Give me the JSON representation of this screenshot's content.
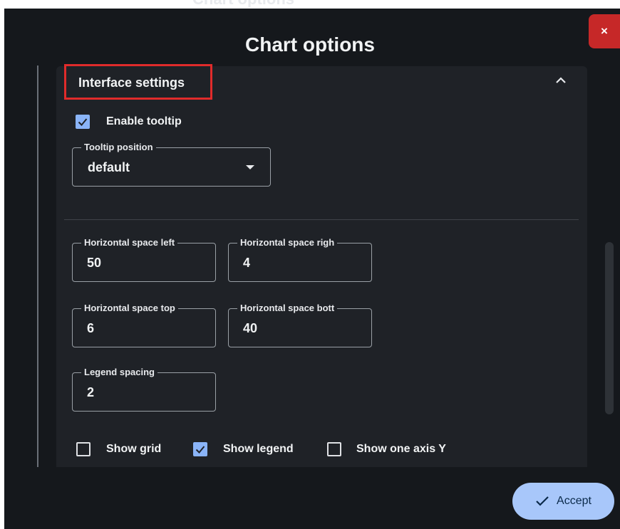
{
  "header_partial": "Chart options",
  "dialog": {
    "title": "Chart options",
    "close_label": "×"
  },
  "section": {
    "title": "Interface settings",
    "expanded": true
  },
  "tooltip": {
    "enable_label": "Enable tooltip",
    "enabled": true,
    "position_label": "Tooltip position",
    "position_value": "default"
  },
  "spacing": {
    "left": {
      "label": "Horizontal space left",
      "value": "50"
    },
    "right": {
      "label": "Horizontal space righ",
      "value": "4"
    },
    "top": {
      "label": "Horizontal space top",
      "value": "6"
    },
    "bottom": {
      "label": "Horizontal space bott",
      "value": "40"
    },
    "legend": {
      "label": "Legend spacing",
      "value": "2"
    }
  },
  "options": {
    "show_grid": {
      "label": "Show grid",
      "checked": false
    },
    "show_legend": {
      "label": "Show legend",
      "checked": true
    },
    "show_one_axis_y": {
      "label": "Show one axis Y",
      "checked": false
    }
  },
  "footer": {
    "accept_label": "Accept"
  },
  "colors": {
    "background": "#15181c",
    "panel": "#1f2227",
    "accent": "#8ab4f8",
    "close": "#c62828",
    "highlight": "#e02b2b"
  },
  "icons": [
    "close-icon",
    "chevron-up-icon",
    "check-icon",
    "dropdown-arrow-icon"
  ]
}
